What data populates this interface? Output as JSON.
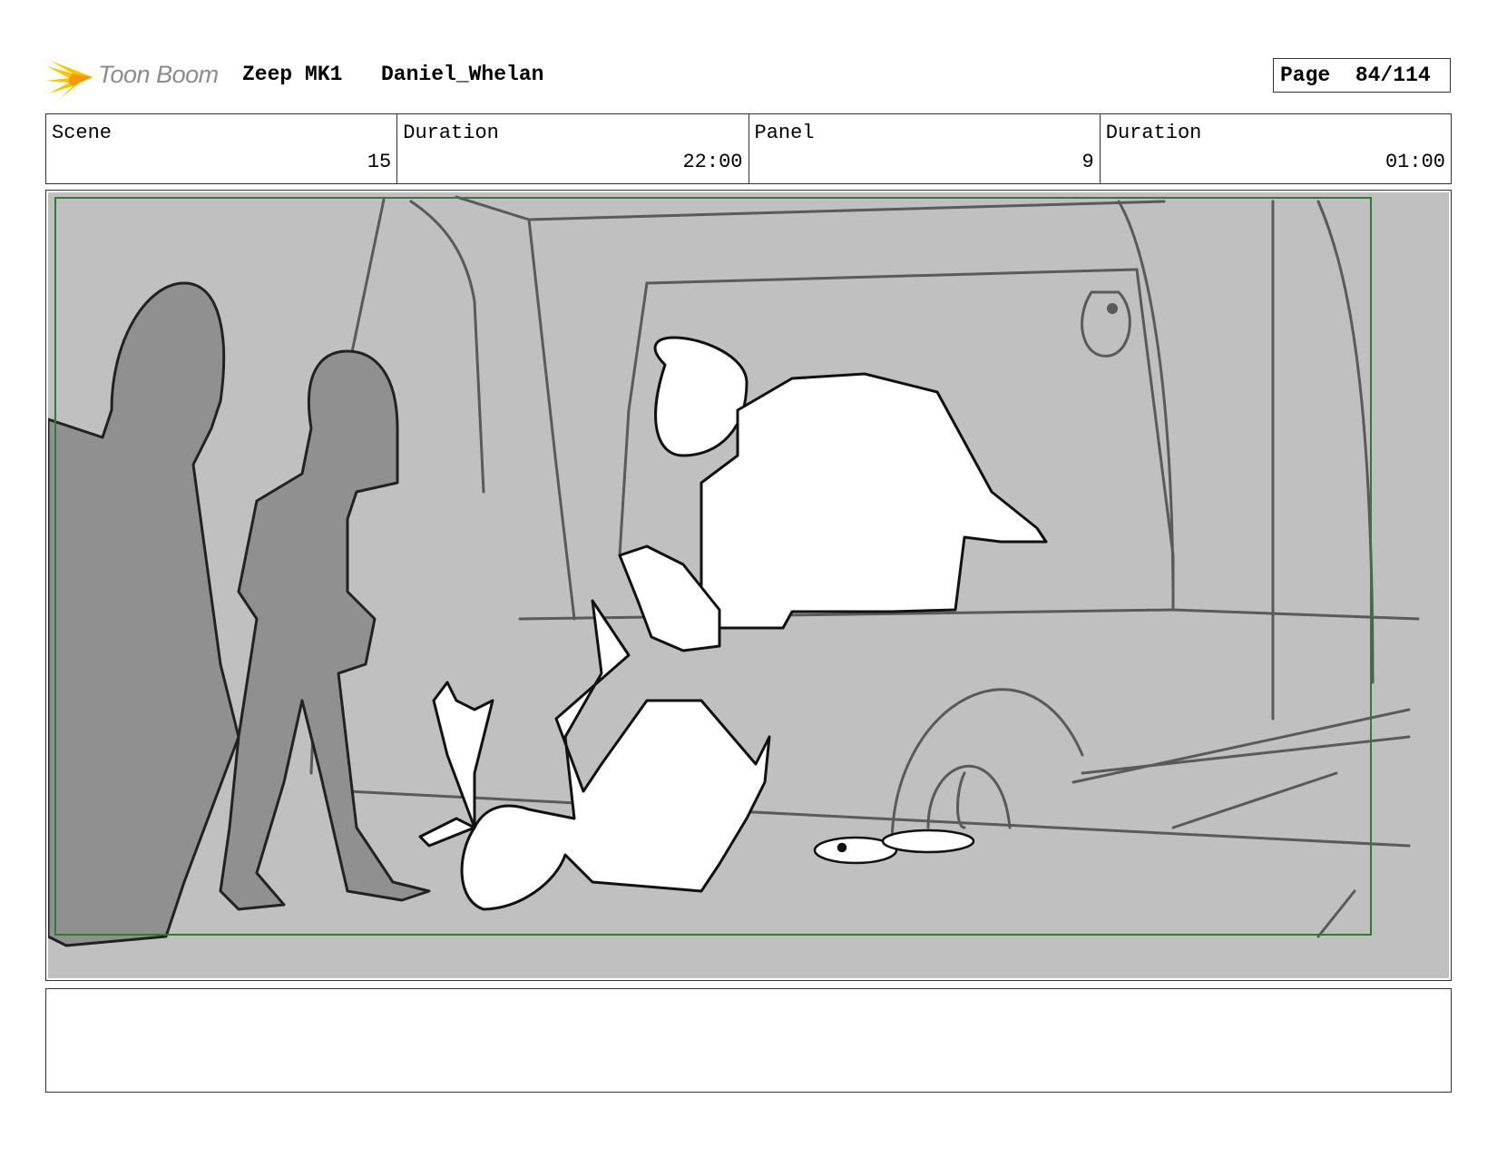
{
  "header": {
    "logo_text": "Toon Boom",
    "project": "Zeep MK1",
    "author": "Daniel_Whelan",
    "page_label": "Page",
    "page_number": "84/114"
  },
  "info": {
    "scene_label": "Scene",
    "scene_value": "15",
    "scene_duration_label": "Duration",
    "scene_duration_value": "22:00",
    "panel_label": "Panel",
    "panel_value": "9",
    "panel_duration_label": "Duration",
    "panel_duration_value": "01:00"
  },
  "colors": {
    "panel_bg": "#c0c0c0",
    "safe_frame": "#2e7d32",
    "figure_gray": "#909090",
    "logo_yellow": "#f7c600"
  },
  "notes": {
    "text": ""
  }
}
